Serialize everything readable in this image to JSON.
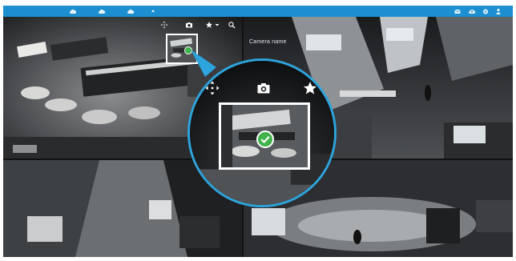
{
  "topbar": {
    "accent_color": "#1c8fd0",
    "left_icons": [
      "cloud-icon",
      "cloud-icon",
      "cloud-icon",
      "sort-icon"
    ],
    "right_icons": [
      "mail-icon",
      "cloud-upload-icon",
      "gear-icon",
      "user-icon"
    ]
  },
  "camera": {
    "name": "Camera name"
  },
  "tile_toolbar": {
    "icons": [
      "move-icon",
      "camera-icon",
      "star-icon",
      "chevron-down-icon",
      "zoom-icon"
    ]
  },
  "zoom_callout": {
    "border_color": "#2ea4dc",
    "icons": [
      "move-icon",
      "camera-icon",
      "star-icon"
    ],
    "selected_check_color": "#3fb24b"
  },
  "tiles": [
    {
      "scene": "fisheye-office-overview"
    },
    {
      "scene": "hallway-with-person"
    },
    {
      "scene": "fisheye-corridor"
    },
    {
      "scene": "lobby-with-reception"
    }
  ]
}
